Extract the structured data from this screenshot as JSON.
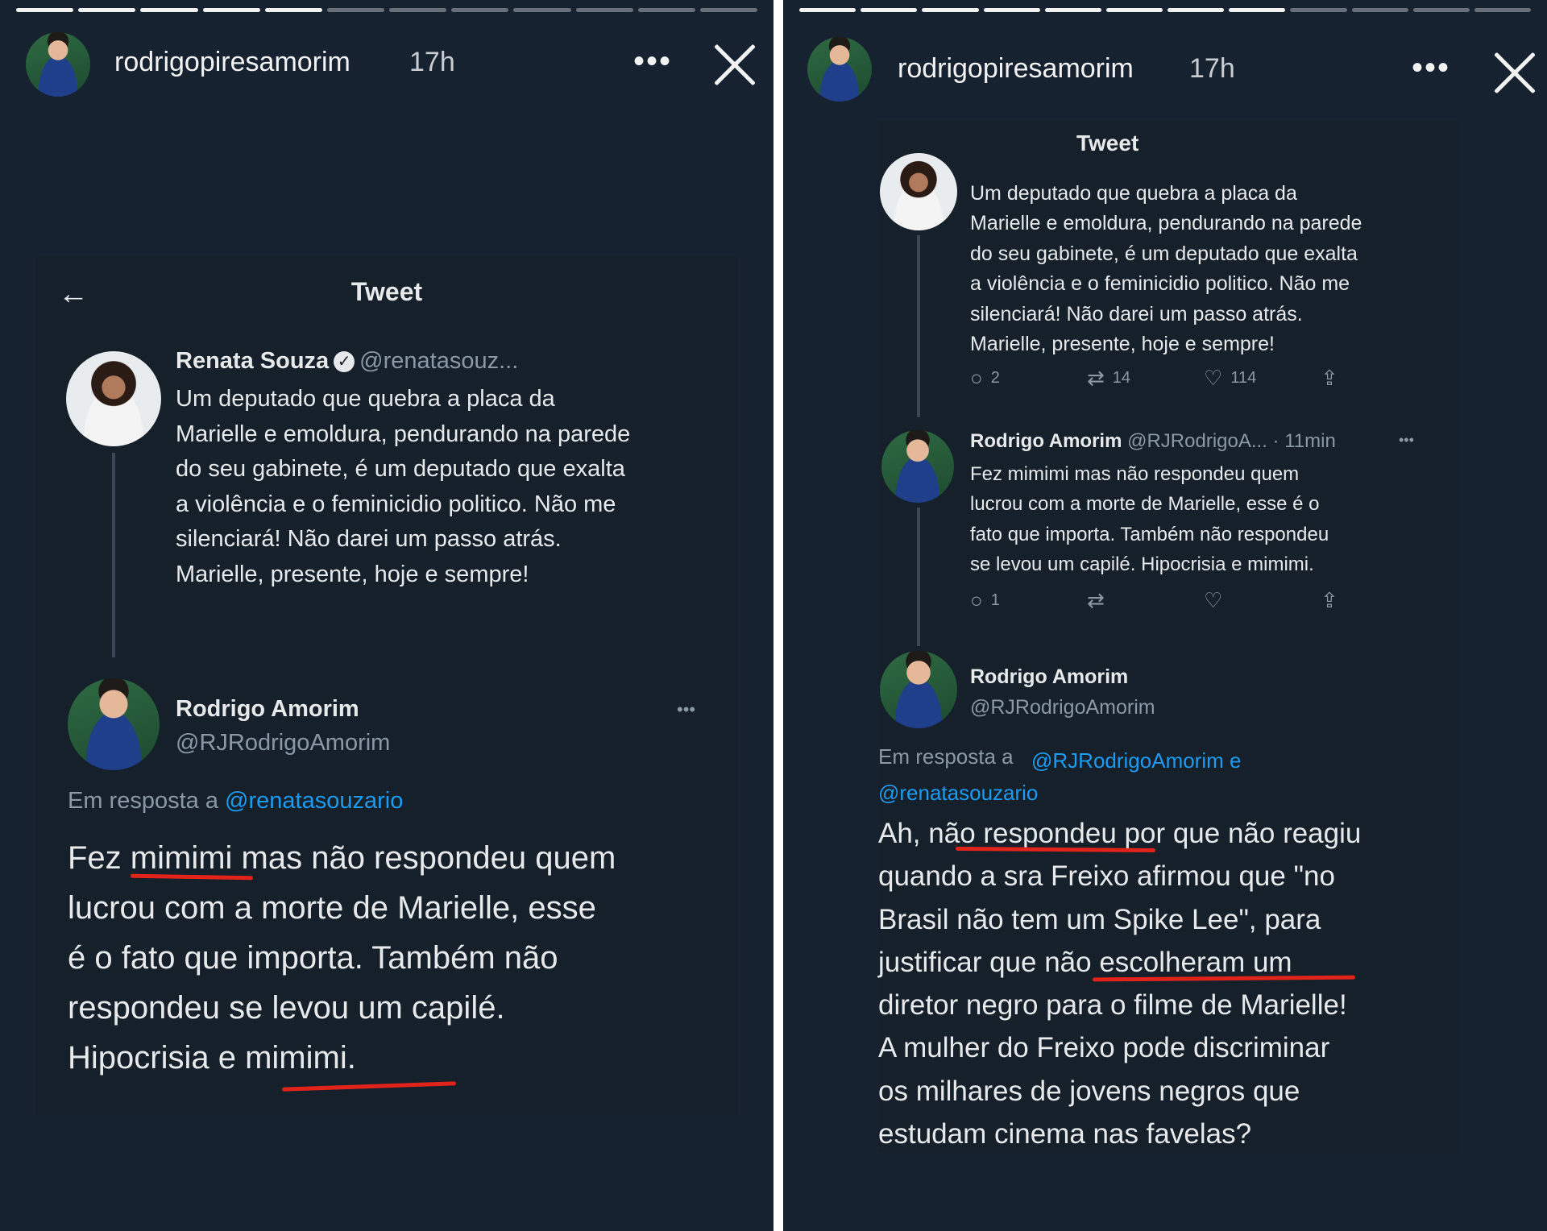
{
  "left": {
    "story": {
      "username": "rodrigopiresamorim",
      "time": "17h",
      "more": "•••"
    },
    "tweet_header": {
      "back": "←",
      "title": "Tweet"
    },
    "parent": {
      "name": "Renata Souza",
      "handle": "@renatasouz...",
      "text": "Um deputado que quebra a placa da\nMarielle e emoldura, pendurando na parede\ndo seu gabinete, é um deputado que exalta\na violência e o feminicidio politico. Não me\nsilenciará! Não darei um passo atrás.\nMarielle, presente, hoje e sempre!"
    },
    "reply": {
      "name": "Rodrigo Amorim",
      "handle": "@RJRodrigoAmorim",
      "more": "•••",
      "replying_prefix": "Em resposta a",
      "replying_to": "@renatasouzario",
      "text": "Fez mimimi mas não respondeu quem\nlucrou com a morte de Marielle, esse\né o fato que importa. Também não\nrespondeu se levou um capilé.\nHipocrisia e mimimi."
    }
  },
  "right": {
    "story": {
      "username": "rodrigopiresamorim",
      "time": "17h",
      "more": "•••"
    },
    "tweet_header": {
      "title": "Tweet"
    },
    "tweet1": {
      "text": "Um deputado que quebra a placa da\nMarielle e emoldura, pendurando na parede\ndo seu gabinete, é um deputado que exalta\na violência e o feminicidio politico. Não me\nsilenciará! Não darei um passo atrás.\nMarielle, presente, hoje e sempre!",
      "replies": "2",
      "retweets": "14",
      "likes": "114"
    },
    "tweet2": {
      "name": "Rodrigo Amorim",
      "handle": "@RJRodrigoA...",
      "time": "· 11min",
      "more": "•••",
      "text": "Fez mimimi mas não respondeu quem\nlucrou com a morte de Marielle, esse é o\nfato que importa. Também não respondeu\nse levou um capilé. Hipocrisia e mimimi.",
      "replies": "1"
    },
    "tweet3": {
      "name": "Rodrigo Amorim",
      "handle": "@RJRodrigoAmorim",
      "replying_prefix": "Em resposta a",
      "replying_to": "@RJRodrigoAmorim e\n@renatasouzario",
      "text": "Ah, não respondeu por que não reagiu\nquando a sra Freixo afirmou que \"no\nBrasil não tem um Spike Lee\", para\njustificar que não escolheram um\ndiretor negro para o filme de Marielle!\nA mulher do Freixo pode discriminar\nos milhares de jovens negros que\nestudam cinema nas favelas?"
    }
  },
  "icons": {
    "reply": "reply-icon",
    "retweet": "retweet-icon",
    "like": "heart-icon",
    "share": "share-icon"
  },
  "colors": {
    "background": "#172230",
    "card": "#15202b",
    "link": "#1d9bf0",
    "underline": "#e2231a"
  }
}
